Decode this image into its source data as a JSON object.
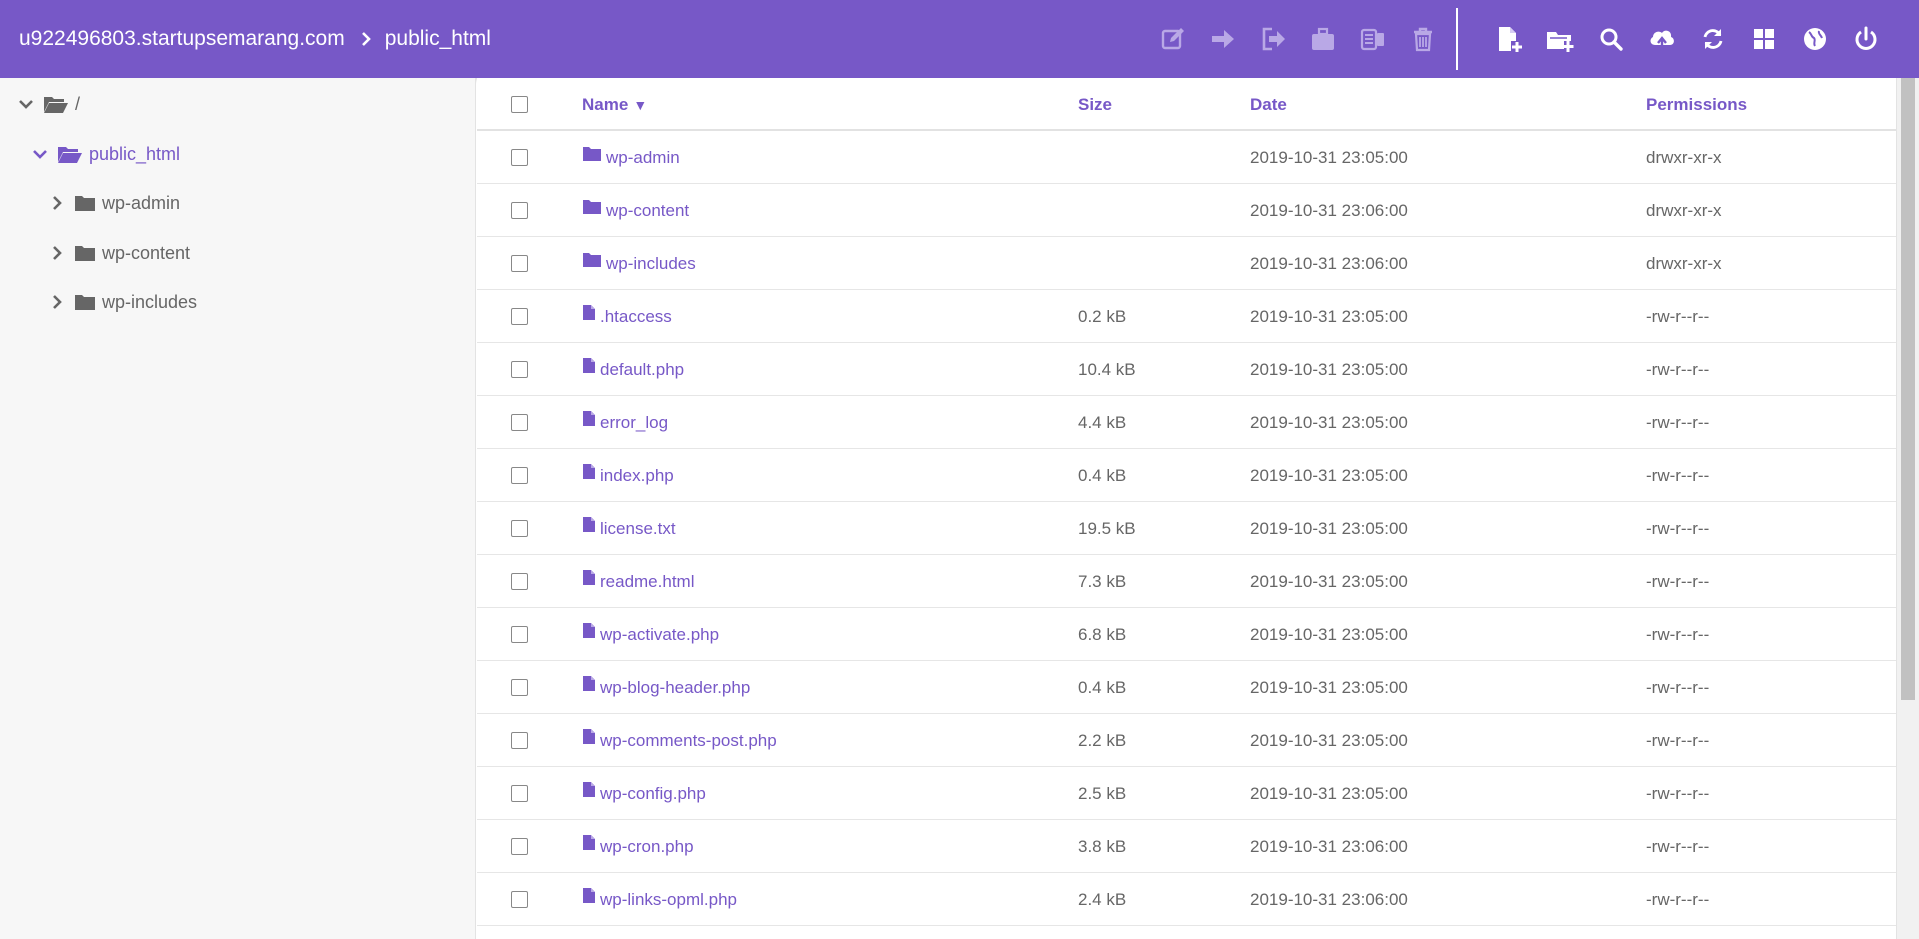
{
  "colors": {
    "accent": "#7758c7",
    "header_bg": "#7758c7",
    "sidebar_bg": "#f7f7f7"
  },
  "breadcrumb": {
    "domain": "u922496803.startupsemarang.com",
    "current": "public_html"
  },
  "toolbar": {
    "selection_actions": [
      "edit-icon",
      "move-icon",
      "exit-icon",
      "archive-icon",
      "extract-icon",
      "trash-icon"
    ],
    "global_actions": [
      "new-file-icon",
      "new-folder-icon",
      "search-icon",
      "upload-icon",
      "refresh-icon",
      "grid-view-icon",
      "globe-icon",
      "power-icon"
    ]
  },
  "sidebar": {
    "root_label": "/",
    "items": [
      {
        "label": "public_html"
      },
      {
        "label": "wp-admin"
      },
      {
        "label": "wp-content"
      },
      {
        "label": "wp-includes"
      }
    ]
  },
  "table": {
    "headers": {
      "name": "Name",
      "sort_indicator": "▼",
      "size": "Size",
      "date": "Date",
      "permissions": "Permissions"
    },
    "rows": [
      {
        "name": "wp-admin",
        "type": "folder",
        "size": "",
        "date": "2019-10-31 23:05:00",
        "perms": "drwxr-xr-x"
      },
      {
        "name": "wp-content",
        "type": "folder",
        "size": "",
        "date": "2019-10-31 23:06:00",
        "perms": "drwxr-xr-x"
      },
      {
        "name": "wp-includes",
        "type": "folder",
        "size": "",
        "date": "2019-10-31 23:06:00",
        "perms": "drwxr-xr-x"
      },
      {
        "name": ".htaccess",
        "type": "file",
        "size": "0.2 kB",
        "date": "2019-10-31 23:05:00",
        "perms": "-rw-r--r--"
      },
      {
        "name": "default.php",
        "type": "file",
        "size": "10.4 kB",
        "date": "2019-10-31 23:05:00",
        "perms": "-rw-r--r--"
      },
      {
        "name": "error_log",
        "type": "file",
        "size": "4.4 kB",
        "date": "2019-10-31 23:05:00",
        "perms": "-rw-r--r--"
      },
      {
        "name": "index.php",
        "type": "file",
        "size": "0.4 kB",
        "date": "2019-10-31 23:05:00",
        "perms": "-rw-r--r--"
      },
      {
        "name": "license.txt",
        "type": "file",
        "size": "19.5 kB",
        "date": "2019-10-31 23:05:00",
        "perms": "-rw-r--r--"
      },
      {
        "name": "readme.html",
        "type": "file",
        "size": "7.3 kB",
        "date": "2019-10-31 23:05:00",
        "perms": "-rw-r--r--"
      },
      {
        "name": "wp-activate.php",
        "type": "file",
        "size": "6.8 kB",
        "date": "2019-10-31 23:05:00",
        "perms": "-rw-r--r--"
      },
      {
        "name": "wp-blog-header.php",
        "type": "file",
        "size": "0.4 kB",
        "date": "2019-10-31 23:05:00",
        "perms": "-rw-r--r--"
      },
      {
        "name": "wp-comments-post.php",
        "type": "file",
        "size": "2.2 kB",
        "date": "2019-10-31 23:05:00",
        "perms": "-rw-r--r--"
      },
      {
        "name": "wp-config.php",
        "type": "file",
        "size": "2.5 kB",
        "date": "2019-10-31 23:05:00",
        "perms": "-rw-r--r--"
      },
      {
        "name": "wp-cron.php",
        "type": "file",
        "size": "3.8 kB",
        "date": "2019-10-31 23:06:00",
        "perms": "-rw-r--r--"
      },
      {
        "name": "wp-links-opml.php",
        "type": "file",
        "size": "2.4 kB",
        "date": "2019-10-31 23:06:00",
        "perms": "-rw-r--r--"
      }
    ]
  }
}
